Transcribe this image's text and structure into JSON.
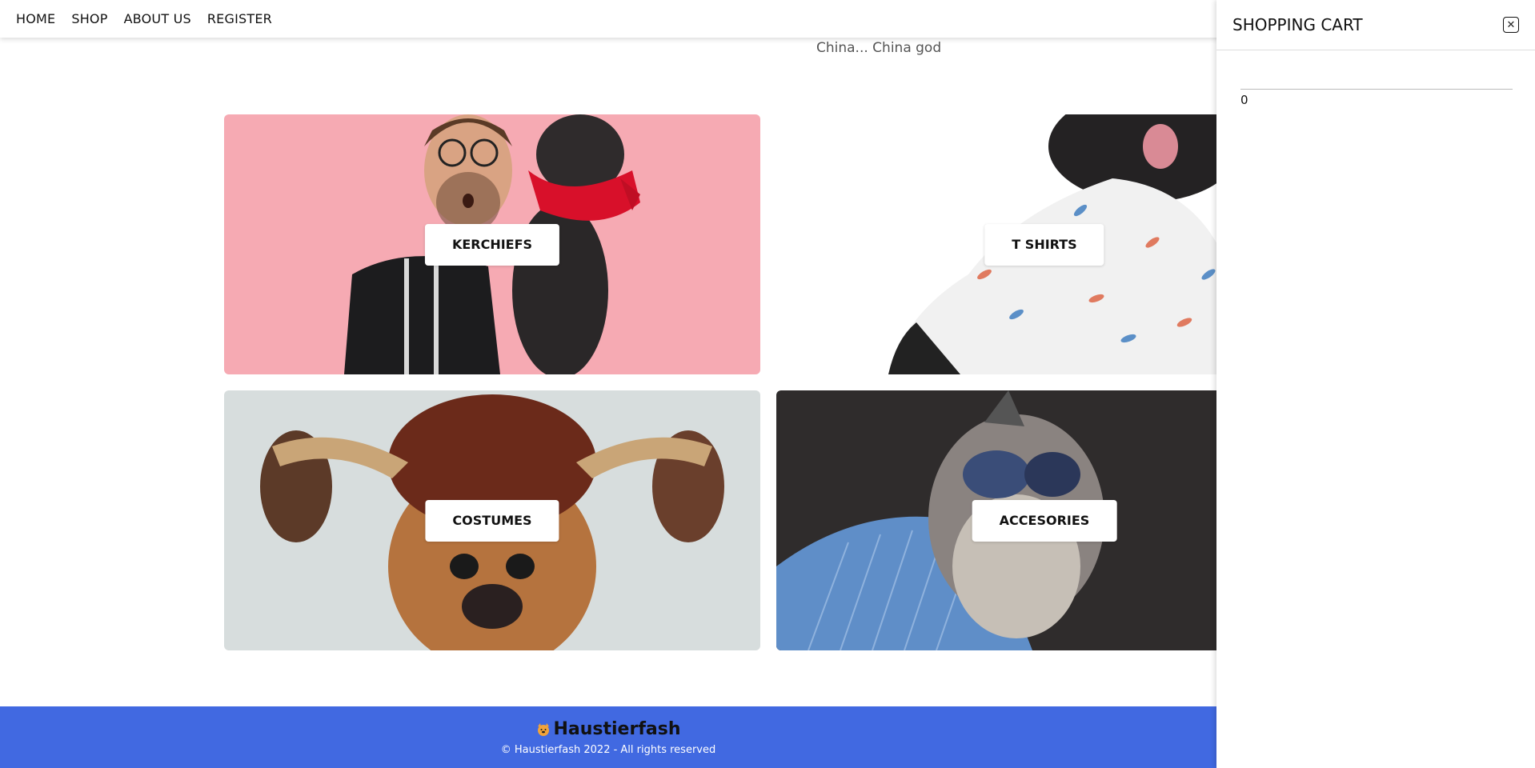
{
  "nav": {
    "links": [
      "HOME",
      "SHOP",
      "ABOUT US",
      "REGISTER"
    ]
  },
  "intro": {
    "text": "China... China god"
  },
  "categories": [
    {
      "label": "KERCHIEFS"
    },
    {
      "label": "T SHIRTS"
    },
    {
      "label": "COSTUMES"
    },
    {
      "label": "ACCESORIES"
    }
  ],
  "footer": {
    "brand": "Haustierfash",
    "copyright": "© Haustierfash 2022 - All rights reserved",
    "logo_icon": "dog-face-icon"
  },
  "cart": {
    "title": "SHOPPING CART",
    "count": "0",
    "close_icon": "close-icon"
  },
  "colors": {
    "footer_bg": "#4169e1",
    "kerchiefs_bg": "#f6aab3"
  }
}
